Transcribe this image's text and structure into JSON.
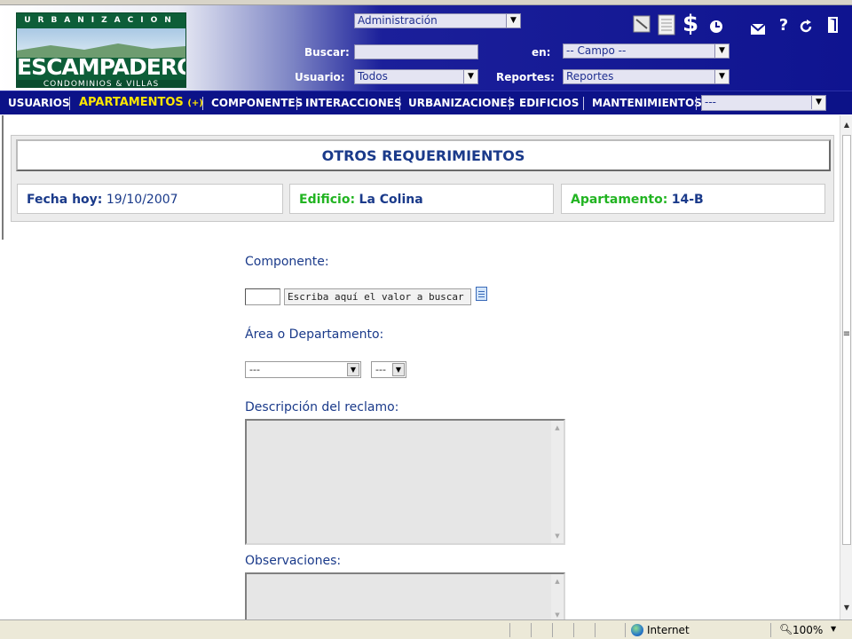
{
  "header": {
    "logo": {
      "top": "URBANIZACION",
      "main": "ESCAMPADERO",
      "sub": "CONDOMINIOS & VILLAS"
    },
    "module_select": "Administración",
    "search_label": "Buscar:",
    "search_value": "",
    "in_label": "en:",
    "field_select": "-- Campo --",
    "user_label": "Usuario:",
    "user_select": "Todos",
    "reports_label": "Reportes:",
    "reports_select": "Reportes",
    "icons": [
      "notepad-icon",
      "document-icon",
      "dollar-icon",
      "clock-icon",
      "mail-icon",
      "help-icon",
      "refresh-icon",
      "exit-icon"
    ],
    "dollar_glyph": "$",
    "help_glyph": "?"
  },
  "nav": {
    "items": [
      "USUARIOS",
      "APARTAMENTOS",
      "COMPONENTES",
      "INTERACCIONES",
      "URBANIZACIONES",
      "EDIFICIOS",
      "MANTENIMIENTOS"
    ],
    "active_suffix": "(+)",
    "extra_select": "---"
  },
  "page": {
    "title": "OTROS REQUERIMIENTOS",
    "date_label": "Fecha hoy:",
    "date_value": "19/10/2007",
    "building_label": "Edificio:",
    "building_value": "La Colina",
    "apartment_label": "Apartamento:",
    "apartment_value": "14-B"
  },
  "form": {
    "component_label": "Componente:",
    "component_code": "",
    "component_search": "Escriba aquí el valor a buscar",
    "area_label": "Área o Departamento:",
    "area_select": "---",
    "area_sub_select": "---",
    "description_label": "Descripción del reclamo:",
    "observations_label": "Observaciones:"
  },
  "statusbar": {
    "zone": "Internet",
    "zoom": "100%"
  },
  "colors": {
    "header_blue": "#0f1490",
    "nav_blue": "#0c1288",
    "active_nav": "#ffe600",
    "label_green": "#22b422",
    "text_blue": "#1a3a8a",
    "logo_green": "#0d5e38"
  }
}
